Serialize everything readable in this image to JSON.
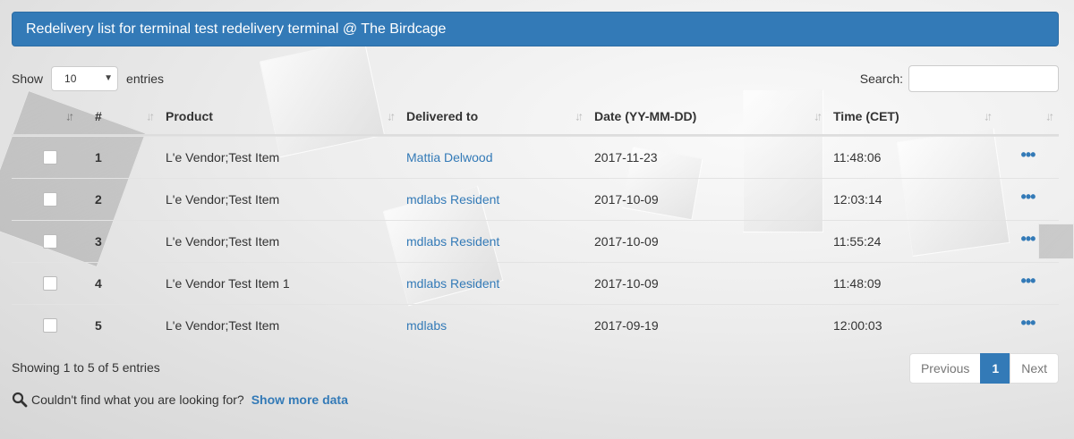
{
  "panel": {
    "title": "Redelivery list for terminal test redelivery terminal @ The Birdcage"
  },
  "length": {
    "show_label": "Show",
    "selected": "10",
    "entries_label": "entries"
  },
  "search": {
    "label": "Search:",
    "value": "",
    "placeholder": ""
  },
  "table": {
    "headers": [
      "#",
      "Product",
      "Delivered to",
      "Date (YY-MM-DD)",
      "Time (CET)"
    ],
    "rows": [
      {
        "num": "1",
        "product": "L'e Vendor;Test Item",
        "delivered_to": "Mattia Delwood",
        "date": "2017-11-23",
        "time": "11:48:06"
      },
      {
        "num": "2",
        "product": "L'e Vendor;Test Item",
        "delivered_to": "mdlabs Resident",
        "date": "2017-10-09",
        "time": "12:03:14"
      },
      {
        "num": "3",
        "product": "L'e Vendor;Test Item",
        "delivered_to": "mdlabs Resident",
        "date": "2017-10-09",
        "time": "11:55:24"
      },
      {
        "num": "4",
        "product": "L'e Vendor Test Item 1",
        "delivered_to": "mdlabs Resident",
        "date": "2017-10-09",
        "time": "11:48:09"
      },
      {
        "num": "5",
        "product": "L'e Vendor;Test Item",
        "delivered_to": "mdlabs",
        "date": "2017-09-19",
        "time": "12:00:03"
      }
    ],
    "actions_glyph": "•••",
    "sort_glyph": "↓↑"
  },
  "info": {
    "text": "Showing 1 to 5 of 5 entries"
  },
  "pagination": {
    "previous": "Previous",
    "current": "1",
    "next": "Next"
  },
  "more": {
    "prompt": "Couldn't find what you are looking for?",
    "link": "Show more data",
    "icon": "search-icon"
  },
  "colors": {
    "primary": "#337ab7",
    "border": "#ddd"
  }
}
